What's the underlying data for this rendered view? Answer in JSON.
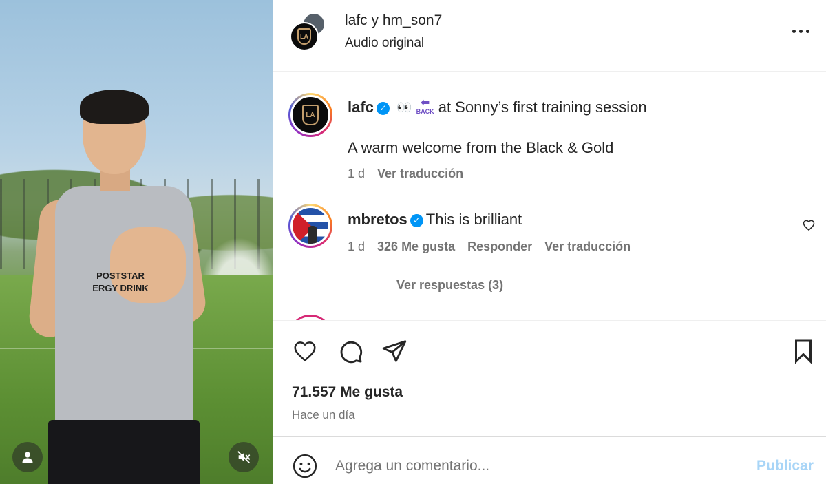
{
  "media": {
    "sponsor_text": "POSTSTAR\nERGY DRINK",
    "user_icon": "user-icon",
    "mute_icon": "speaker-muted-icon"
  },
  "header": {
    "account1": "lafc",
    "connector": " y ",
    "account2": "hm_son7",
    "audio": "Audio original",
    "more_icon": "more-horizontal-icon"
  },
  "caption": {
    "username": "lafc",
    "text": "at Sonny’s first training session",
    "back_label": "BACK",
    "line2": "A warm welcome from the Black & Gold",
    "time": "1 d",
    "translate": "Ver traducción"
  },
  "comment": {
    "username": "mbretos",
    "text": "This is brilliant",
    "time": "1 d",
    "likes": "326 Me gusta",
    "reply": "Responder",
    "translate": "Ver traducción",
    "view_replies": "Ver respuestas (3)"
  },
  "actions": {
    "likes": "71.557 Me gusta",
    "when": "Hace un día"
  },
  "composer": {
    "placeholder": "Agrega un comentario...",
    "publish": "Publicar"
  },
  "colors": {
    "accent": "#0095f6",
    "publish_disabled": "#a8d5f7",
    "text": "#262626",
    "muted": "#737373",
    "lafc_gold": "#c39e6d"
  }
}
